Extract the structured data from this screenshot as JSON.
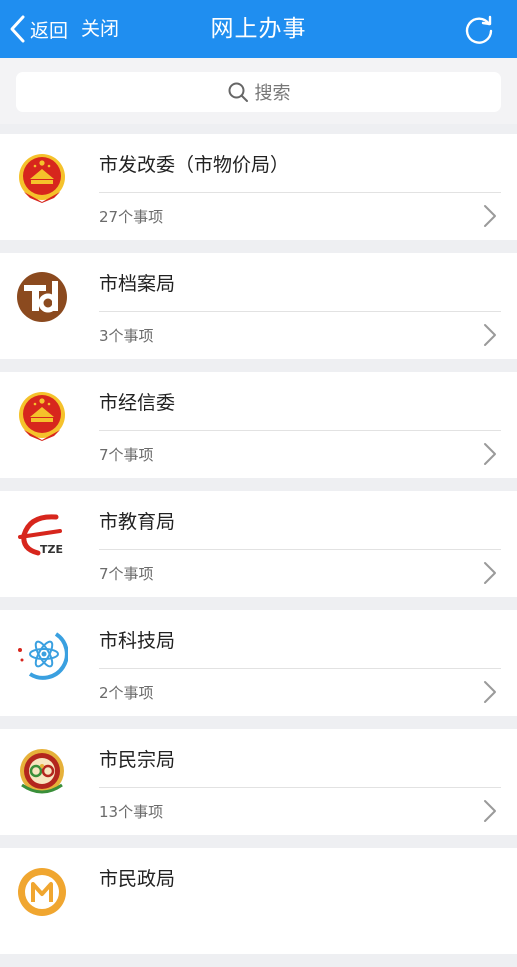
{
  "nav": {
    "back_label": "返回",
    "close_label": "关闭",
    "title": "网上办事"
  },
  "search": {
    "label": "搜索"
  },
  "departments": [
    {
      "name": "市发改委（市物价局）",
      "count": "27个事项",
      "icon": "national-emblem-icon"
    },
    {
      "name": "市档案局",
      "count": "3个事项",
      "icon": "td-logo-icon"
    },
    {
      "name": "市经信委",
      "count": "7个事项",
      "icon": "national-emblem-icon"
    },
    {
      "name": "市教育局",
      "count": "7个事项",
      "icon": "tze-logo-icon"
    },
    {
      "name": "市科技局",
      "count": "2个事项",
      "icon": "atom-logo-icon"
    },
    {
      "name": "市民宗局",
      "count": "13个事项",
      "icon": "ethnic-affairs-emblem-icon"
    },
    {
      "name": "市民政局",
      "count": "",
      "icon": "civil-affairs-logo-icon"
    }
  ],
  "colors": {
    "accent": "#1f8ef0",
    "emblem_red": "#d7261d",
    "emblem_gold": "#f5c22b",
    "archive_brown": "#8b4a1f",
    "science_blue": "#3aa0e0"
  }
}
